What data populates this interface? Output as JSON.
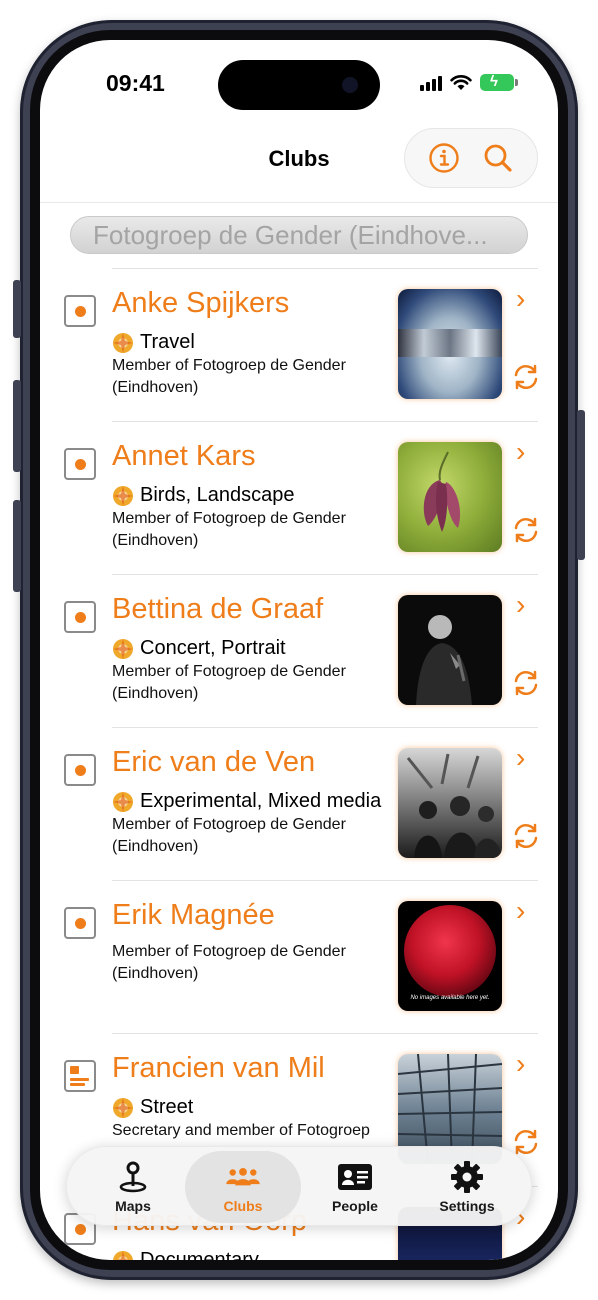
{
  "status_bar": {
    "time": "09:41"
  },
  "nav": {
    "title": "Clubs",
    "info_icon": "info-icon",
    "search_icon": "search-icon"
  },
  "filter": {
    "label": "Fotogroep de Gender (Eindhove..."
  },
  "members": [
    {
      "name": "Anke Spijkers",
      "tags": "Travel",
      "member_line": "Member of Fotogroep de Gender (Eindhoven)",
      "icon": "checkbox-icon",
      "photo": "abstract-blue-photo"
    },
    {
      "name": "Annet Kars",
      "tags": "Birds, Landscape",
      "member_line": "Member of Fotogroep de Gender (Eindhoven)",
      "icon": "checkbox-icon",
      "photo": "flower-photo"
    },
    {
      "name": "Bettina de Graaf",
      "tags": "Concert, Portrait",
      "member_line": "Member of Fotogroep de Gender (Eindhoven)",
      "icon": "checkbox-icon",
      "photo": "singer-photo"
    },
    {
      "name": "Eric van de Ven",
      "tags": "Experimental, Mixed media",
      "member_line": "Member of Fotogroep de Gender (Eindhoven)",
      "icon": "checkbox-icon",
      "photo": "crowd-photo"
    },
    {
      "name": "Erik Magnée",
      "tags": "",
      "member_line": "Member of Fotogroep de Gender (Eindhoven)",
      "icon": "checkbox-icon",
      "photo": "placeholder-photo",
      "photo_caption": "No images available here yet."
    },
    {
      "name": "Francien van Mil",
      "tags": "Street",
      "member_line": "Secretary and member of Fotogroep",
      "icon": "document-icon",
      "photo": "architecture-photo"
    },
    {
      "name": "Hans van Oorp",
      "tags": "Documentary",
      "member_line": "",
      "icon": "checkbox-icon",
      "photo": "dark-photo"
    }
  ],
  "tabs": [
    {
      "label": "Maps",
      "icon": "map-pin-icon",
      "active": false
    },
    {
      "label": "Clubs",
      "icon": "group-icon",
      "active": true
    },
    {
      "label": "People",
      "icon": "id-card-icon",
      "active": false
    },
    {
      "label": "Settings",
      "icon": "gear-icon",
      "active": false
    }
  ],
  "colors": {
    "accent": "#ee7d1a",
    "tag_icon": "#f0a82a"
  }
}
